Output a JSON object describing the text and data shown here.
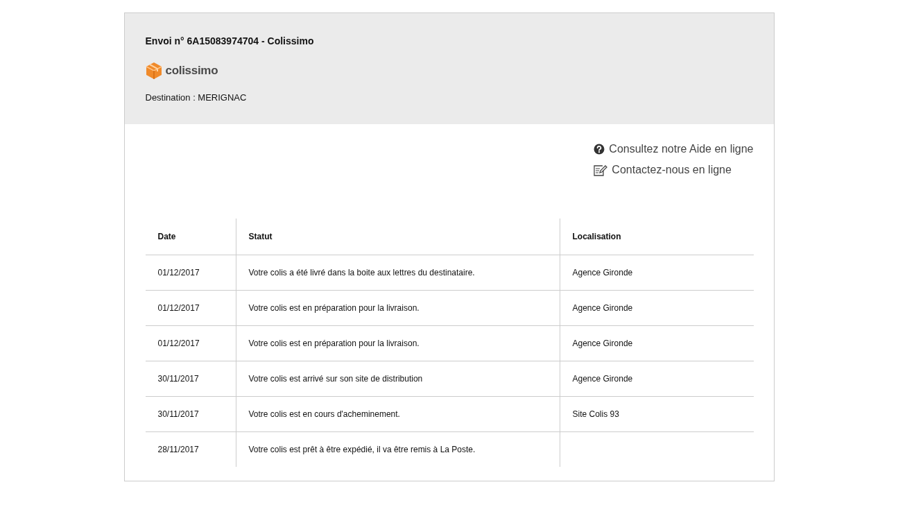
{
  "header": {
    "title": "Envoi n° 6A15083974704 - Colissimo",
    "logo_text": "colissimo",
    "destination": "Destination : MERIGNAC"
  },
  "links": [
    {
      "kind": "help",
      "label": "Consultez notre Aide en ligne"
    },
    {
      "kind": "contact",
      "label": "Contactez-nous en ligne"
    }
  ],
  "table": {
    "columns": [
      "Date",
      "Statut",
      "Localisation"
    ],
    "rows": [
      [
        "01/12/2017",
        "Votre colis a été livré dans la boite aux lettres du destinataire.",
        "Agence Gironde"
      ],
      [
        "01/12/2017",
        "Votre colis est en préparation pour la livraison.",
        "Agence Gironde"
      ],
      [
        "01/12/2017",
        "Votre colis est en préparation pour la livraison.",
        "Agence Gironde"
      ],
      [
        "30/11/2017",
        "Votre colis est arrivé sur son site de distribution",
        "Agence Gironde"
      ],
      [
        "30/11/2017",
        "Votre colis est en cours d'acheminement.",
        "Site Colis 93"
      ],
      [
        "28/11/2017",
        "Votre colis est prêt à être expédié, il va être remis à La Poste.",
        ""
      ]
    ]
  }
}
